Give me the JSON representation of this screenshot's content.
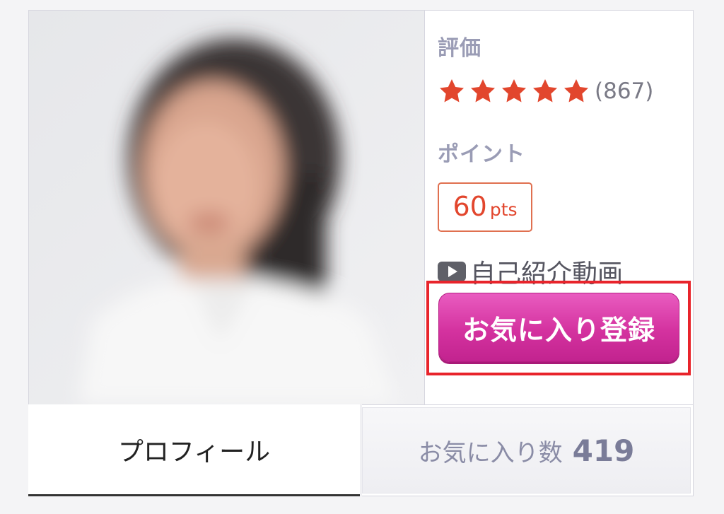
{
  "profile": {
    "photo": {
      "alt": "profile-photo",
      "blurred": true
    },
    "rating": {
      "label": "評価",
      "stars": 5,
      "count": "(867)",
      "star_color": "#e2462d"
    },
    "points": {
      "label": "ポイント",
      "value": "60",
      "unit": "pts",
      "color": "#e2462d"
    },
    "video": {
      "icon": "play-icon",
      "label": "自己紹介動画"
    },
    "favorite_button": {
      "label": "お気に入り登録",
      "color": "#d4329f"
    }
  },
  "tabs": {
    "profile": {
      "label": "プロフィール"
    },
    "favorites": {
      "label": "お気に入り数",
      "count": "419"
    }
  }
}
